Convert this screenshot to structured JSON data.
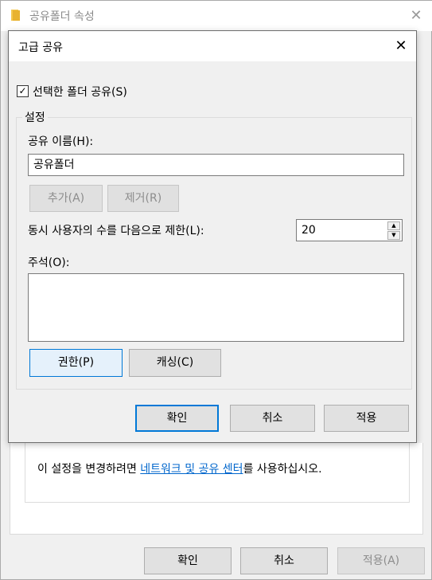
{
  "properties_window": {
    "title": "공유폴더 속성",
    "info_prefix": "이 설정을 변경하려면 ",
    "info_link": "네트워크 및 공유 센터",
    "info_suffix": "를 사용하십시오.",
    "buttons": {
      "ok": "확인",
      "cancel": "취소",
      "apply": "적용(A)"
    }
  },
  "dialog": {
    "title": "고급 공유",
    "share_checkbox": {
      "label": "선택한 폴더 공유(S)",
      "checked": true
    },
    "settings_group": "설정",
    "share_name": {
      "label": "공유 이름(H):",
      "value": "공유폴더"
    },
    "add_button": "추가(A)",
    "remove_button": "제거(R)",
    "user_limit": {
      "label": "동시 사용자의 수를 다음으로 제한(L):",
      "value": "20"
    },
    "comment": {
      "label": "주석(O):",
      "value": ""
    },
    "permissions_button": "권한(P)",
    "caching_button": "캐싱(C)",
    "buttons": {
      "ok": "확인",
      "cancel": "취소",
      "apply": "적용"
    }
  },
  "colors": {
    "accent": "#0078d7",
    "link": "#0066cc",
    "window_bg": "#f0f0f0"
  }
}
